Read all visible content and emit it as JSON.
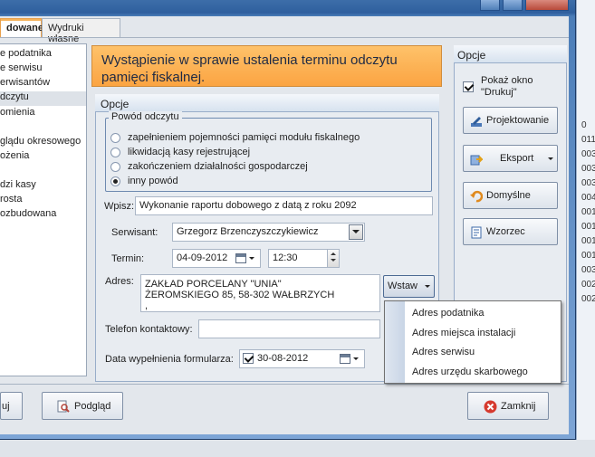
{
  "window": {
    "tabs": [
      {
        "label": "dowane",
        "active": true
      },
      {
        "label": "Wydruki własne",
        "active": false
      }
    ]
  },
  "left_list": {
    "items": [
      {
        "label": "e podatnika",
        "selected": false
      },
      {
        "label": "e serwisu",
        "selected": false
      },
      {
        "label": "erwisantów",
        "selected": false
      },
      {
        "label": "dczytu",
        "selected": true
      },
      {
        "label": "omienia",
        "selected": false
      },
      {
        "label": "",
        "selected": false
      },
      {
        "label": "glądu okresowego",
        "selected": false
      },
      {
        "label": "ożenia",
        "selected": false
      },
      {
        "label": "",
        "selected": false
      },
      {
        "label": "dzi kasy",
        "selected": false
      },
      {
        "label": "rosta",
        "selected": false
      },
      {
        "label": "ozbudowana",
        "selected": false
      }
    ]
  },
  "banner": {
    "title": "Wystąpienie w sprawie ustalenia terminu odczytu pamięci fiskalnej."
  },
  "options_panel": {
    "header": "Opcje",
    "reason": {
      "legend": "Powód odczytu",
      "options": [
        {
          "label": "zapełnieniem pojemności pamięci modułu fiskalnego",
          "selected": false
        },
        {
          "label": "likwidacją kasy rejestrującej",
          "selected": false
        },
        {
          "label": "zakończeniem działalności gospodarczej",
          "selected": false
        },
        {
          "label": "inny powód",
          "selected": true
        }
      ]
    },
    "wpisz": {
      "label": "Wpisz:",
      "value": "Wykonanie raportu dobowego z datą z roku 2092"
    },
    "serwisant": {
      "label": "Serwisant:",
      "value": "Grzegorz Brzenczyszczykiewicz"
    },
    "termin": {
      "label": "Termin:",
      "date": "04-09-2012",
      "time": "12:30"
    },
    "adres": {
      "label": "Adres:",
      "lines": [
        "ZAKŁAD PORCELANY \"UNIA\"",
        "ŻEROMSKIEGO 85, 58-302 WAŁBRZYCH",
        ","
      ],
      "insert_button": "Wstaw"
    },
    "telefon": {
      "label": "Telefon kontaktowy:",
      "value": ""
    },
    "data_wypelnienia": {
      "label": "Data wypełnienia formularza:",
      "checked": true,
      "date": "30-08-2012"
    }
  },
  "insert_menu": {
    "items": [
      "Adres podatnika",
      "Adres miejsca instalacji",
      "Adres serwisu",
      "Adres urzędu skarbowego"
    ]
  },
  "right_panel": {
    "header": "Opcje",
    "show_window": {
      "checked": true,
      "label_line1": "Pokaż okno",
      "label_line2": "\"Drukuj\""
    },
    "buttons": [
      {
        "label": "Projektowanie",
        "icon": "design-icon"
      },
      {
        "label": "Eksport",
        "icon": "export-icon"
      },
      {
        "label": "Domyślne",
        "icon": "undo-icon"
      },
      {
        "label": "Wzorzec",
        "icon": "template-icon"
      }
    ]
  },
  "footer": {
    "print_label": "uj",
    "preview_label": "Podgląd",
    "close_label": "Zamknij"
  },
  "background": {
    "right_numbers": [
      "0",
      "011",
      "003",
      "003",
      "003",
      "004",
      "001",
      "001",
      "001",
      "001",
      "003",
      "002",
      "002"
    ]
  },
  "colors": {
    "banner": "#fba442",
    "active_tab_border": "#e8a04c",
    "close_icon": "#d63a2f",
    "frame": "#3d6ea9"
  }
}
